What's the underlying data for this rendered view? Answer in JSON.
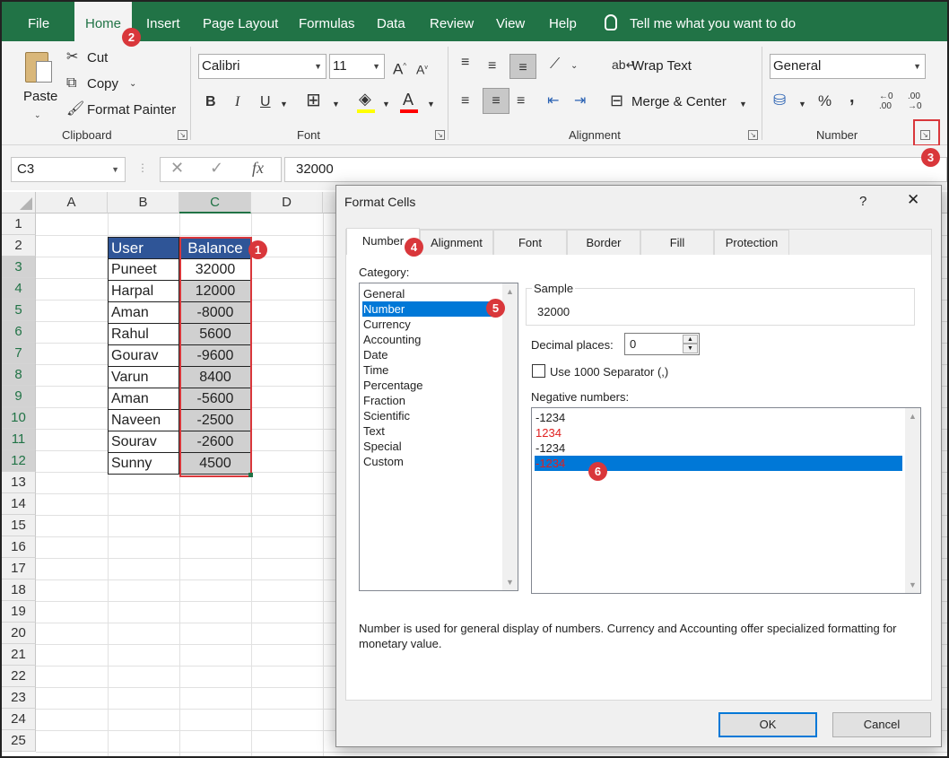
{
  "menu": {
    "file": "File",
    "home": "Home",
    "insert": "Insert",
    "page_layout": "Page Layout",
    "formulas": "Formulas",
    "data": "Data",
    "review": "Review",
    "view": "View",
    "help": "Help",
    "tell_me": "Tell me what you want to do"
  },
  "ribbon": {
    "clipboard": {
      "paste": "Paste",
      "cut": "Cut",
      "copy": "Copy",
      "format_painter": "Format Painter",
      "label": "Clipboard"
    },
    "font": {
      "font_name": "Calibri",
      "font_size": "11",
      "bold": "B",
      "italic": "I",
      "underline": "U",
      "label": "Font"
    },
    "alignment": {
      "wrap_text": "Wrap Text",
      "merge_center": "Merge & Center",
      "label": "Alignment"
    },
    "number": {
      "format": "General",
      "percent": "%",
      "comma": ",",
      "label": "Number"
    }
  },
  "formula_bar": {
    "name_box": "C3",
    "fx": "fx",
    "value": "32000"
  },
  "sheet": {
    "columns": [
      "A",
      "B",
      "C",
      "D"
    ],
    "rows": [
      "1",
      "2",
      "3",
      "4",
      "5",
      "6",
      "7",
      "8",
      "9",
      "10",
      "11",
      "12",
      "13",
      "14",
      "15",
      "16",
      "17",
      "18",
      "19",
      "20",
      "21",
      "22",
      "23",
      "24",
      "25"
    ],
    "header_user": "User",
    "header_balance": "Balance",
    "data": [
      {
        "user": "Puneet",
        "balance": "32000"
      },
      {
        "user": "Harpal",
        "balance": "12000"
      },
      {
        "user": "Aman",
        "balance": "-8000"
      },
      {
        "user": "Rahul",
        "balance": "5600"
      },
      {
        "user": "Gourav",
        "balance": "-9600"
      },
      {
        "user": "Varun",
        "balance": "8400"
      },
      {
        "user": "Aman",
        "balance": "-5600"
      },
      {
        "user": "Naveen",
        "balance": "-2500"
      },
      {
        "user": "Sourav",
        "balance": "-2600"
      },
      {
        "user": "Sunny",
        "balance": "4500"
      }
    ]
  },
  "badges": [
    "1",
    "2",
    "3",
    "4",
    "5",
    "6"
  ],
  "dialog": {
    "title": "Format Cells",
    "help": "?",
    "close": "✕",
    "tabs": [
      "Number",
      "Alignment",
      "Font",
      "Border",
      "Fill",
      "Protection"
    ],
    "category_label": "Category:",
    "categories": [
      "General",
      "Number",
      "Currency",
      "Accounting",
      "Date",
      "Time",
      "Percentage",
      "Fraction",
      "Scientific",
      "Text",
      "Special",
      "Custom"
    ],
    "selected_category": "Number",
    "sample_label": "Sample",
    "sample_value": "32000",
    "decimal_label": "Decimal places:",
    "decimal_value": "0",
    "separator_label": "Use 1000 Separator (,)",
    "negative_label": "Negative numbers:",
    "negative_options": [
      {
        "text": "-1234",
        "color": "#222222"
      },
      {
        "text": "1234",
        "color": "#e02020"
      },
      {
        "text": "-1234",
        "color": "#222222"
      },
      {
        "text": "-1234",
        "color": "#e02020"
      }
    ],
    "description": "Number is used for general display of numbers.  Currency and Accounting offer specialized formatting for monetary value.",
    "ok": "OK",
    "cancel": "Cancel"
  },
  "colors": {
    "excel_green": "#217346",
    "header_blue": "#2f5597",
    "highlight_red": "#d9373b",
    "selection_blue": "#0078d7"
  }
}
